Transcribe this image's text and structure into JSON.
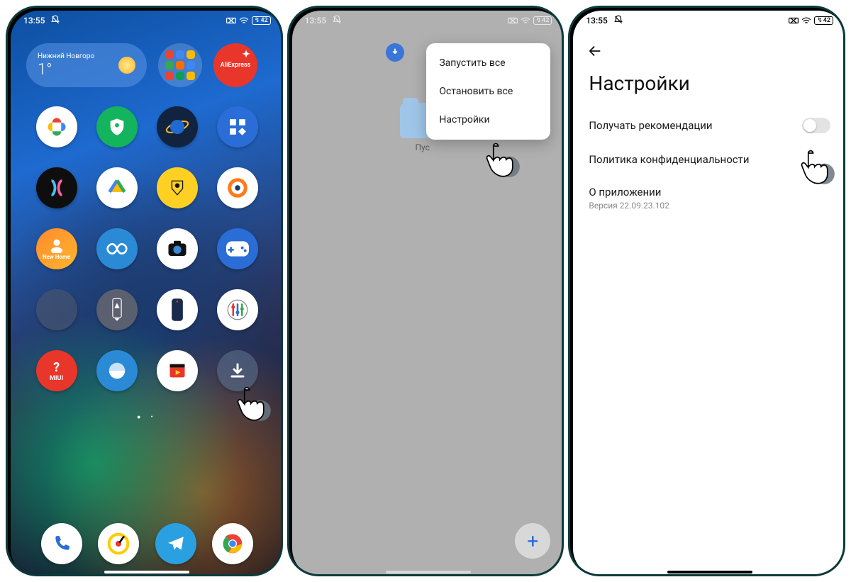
{
  "status": {
    "time": "13:55",
    "battery": "42"
  },
  "home": {
    "weather_city": "Нижний Новгоро",
    "weather_temp": "1°",
    "brand_label": "AliExpress",
    "apps": [
      {
        "name": "photos",
        "bg": "#ffffff"
      },
      {
        "name": "security",
        "bg": "#1bb566"
      },
      {
        "name": "planet",
        "bg": "#1a3a6e"
      },
      {
        "name": "tiles",
        "bg": "#2a6dd6"
      },
      {
        "name": "copilot",
        "bg": "#111111"
      },
      {
        "name": "files",
        "bg": "#ffffff"
      },
      {
        "name": "tinkoff",
        "bg": "#ffd024"
      },
      {
        "name": "openvpn",
        "bg": "#ffffff"
      },
      {
        "name": "newhome",
        "bg": "linear-gradient(135deg,#ff7a2d,#ffb62d)"
      },
      {
        "name": "infinity",
        "bg": "#2a8ad6"
      },
      {
        "name": "camera",
        "bg": "#ffffff"
      },
      {
        "name": "gamepad",
        "bg": "#2a6dd6"
      },
      {
        "name": "folder",
        "bg": "folder"
      },
      {
        "name": "rocket",
        "bg": "#6b7280"
      },
      {
        "name": "phone-shape",
        "bg": "#ffffff"
      },
      {
        "name": "equalizer",
        "bg": "#ffffff"
      },
      {
        "name": "miui",
        "bg": "#e8362a"
      },
      {
        "name": "browser",
        "bg": "#2a8ad6"
      },
      {
        "name": "video",
        "bg": "#ffffff"
      },
      {
        "name": "downloads",
        "bg": "rgba(90,110,140,0.6)"
      }
    ],
    "dock": [
      {
        "name": "phone",
        "bg": "#ffffff"
      },
      {
        "name": "yandex-music",
        "bg": "#ffffff"
      },
      {
        "name": "telegram",
        "bg": "#2aa0e0"
      },
      {
        "name": "chrome",
        "bg": "#ffffff"
      }
    ]
  },
  "downloads": {
    "folder_label": "Пус",
    "menu": {
      "start_all": "Запустить все",
      "stop_all": "Остановить все",
      "settings": "Настройки"
    }
  },
  "settings": {
    "title": "Настройки",
    "recommendations": "Получать рекомендации",
    "privacy": "Политика конфиденциальности",
    "about": "О приложении",
    "version": "Версия 22.09.23.102"
  }
}
